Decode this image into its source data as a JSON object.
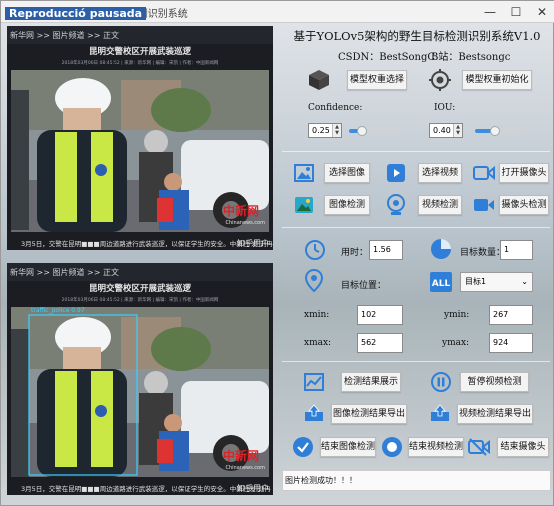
{
  "window": {
    "title": "基于YOLOv5的野生目标检测识别系统",
    "paused": "Reproducció pausada",
    "minimize": "—",
    "maximize": "☐",
    "close": "✕"
  },
  "views": {
    "top": {
      "breadcrumb": "新华网 >> 图片频道 >> 正文",
      "headline": "昆明交警校区开展武装巡逻",
      "meta": "2018年03月06日 08:45:52 | 来源：新华网 | 编辑：宋凯 | 作者：中国新闻网",
      "caption": "3月5日，交警在昆明■■■周边道路进行武装巡逻，以保证学生的安全。中新社 发 刘冉阳 摄",
      "watermark_site": "中新网",
      "watermark_url": "Chinanews.com",
      "watermark_user": "知乎用户"
    },
    "bottom": {
      "breadcrumb": "新华网 >> 图片频道 >> 正文",
      "headline": "昆明交警校区开展武装巡逻",
      "meta": "2018年03月06日 08:45:52 | 来源：新华网 | 编辑：宋凯 | 作者：中国新闻网",
      "det_label": "traffic_police 0.97",
      "caption": "3月5日，交警在昆明■■■周边道路进行武装巡逻，以保证学生的安全。中新社发 刘冉阳 摄",
      "watermark_site": "中新网",
      "watermark_url": "Chinanews.com",
      "watermark_user": "知乎用户"
    }
  },
  "panel": {
    "title": "基于YOLOv5架构的野生目标检测识别系统V1.0",
    "csdn": "CSDN：BestSongC",
    "bilibili": "B站：Bestsongc",
    "model_select": "模型权重选择",
    "model_init": "模型权重初始化",
    "confidence_label": "Confidence:",
    "iou_label": "IOU:",
    "confidence_value": "0.25",
    "iou_value": "0.40",
    "confidence_level": 0.25,
    "iou_level": 0.4,
    "select_image": "选择图像",
    "select_video": "选择视频",
    "open_camera": "打开摄像头",
    "image_detect": "图像检测",
    "video_detect": "视频检测",
    "camera_detect": "摄像头检测",
    "time_label": "用时：",
    "time_value": "1.56",
    "count_label": "目标数量：",
    "count_value": "1",
    "position_label": "目标位置：",
    "target_select": "目标1",
    "xmin_label": "xmin:",
    "xmin_value": "102",
    "ymin_label": "ymin:",
    "ymin_value": "267",
    "xmax_label": "xmax:",
    "xmax_value": "562",
    "ymax_label": "ymax:",
    "ymax_value": "924",
    "show_results": "检测结果展示",
    "pause_video": "暂停视频检测",
    "export_image": "图像检测结果导出",
    "export_video": "视频检测结果导出",
    "end_image": "结束图像检测",
    "end_video": "结束视频检测",
    "end_camera": "结束摄像头",
    "status": "图片检测成功！！！"
  },
  "colors": {
    "accent": "#3e8ee0",
    "icon_blue": "#2f7fd8",
    "icon_teal": "#2aa6c8"
  }
}
